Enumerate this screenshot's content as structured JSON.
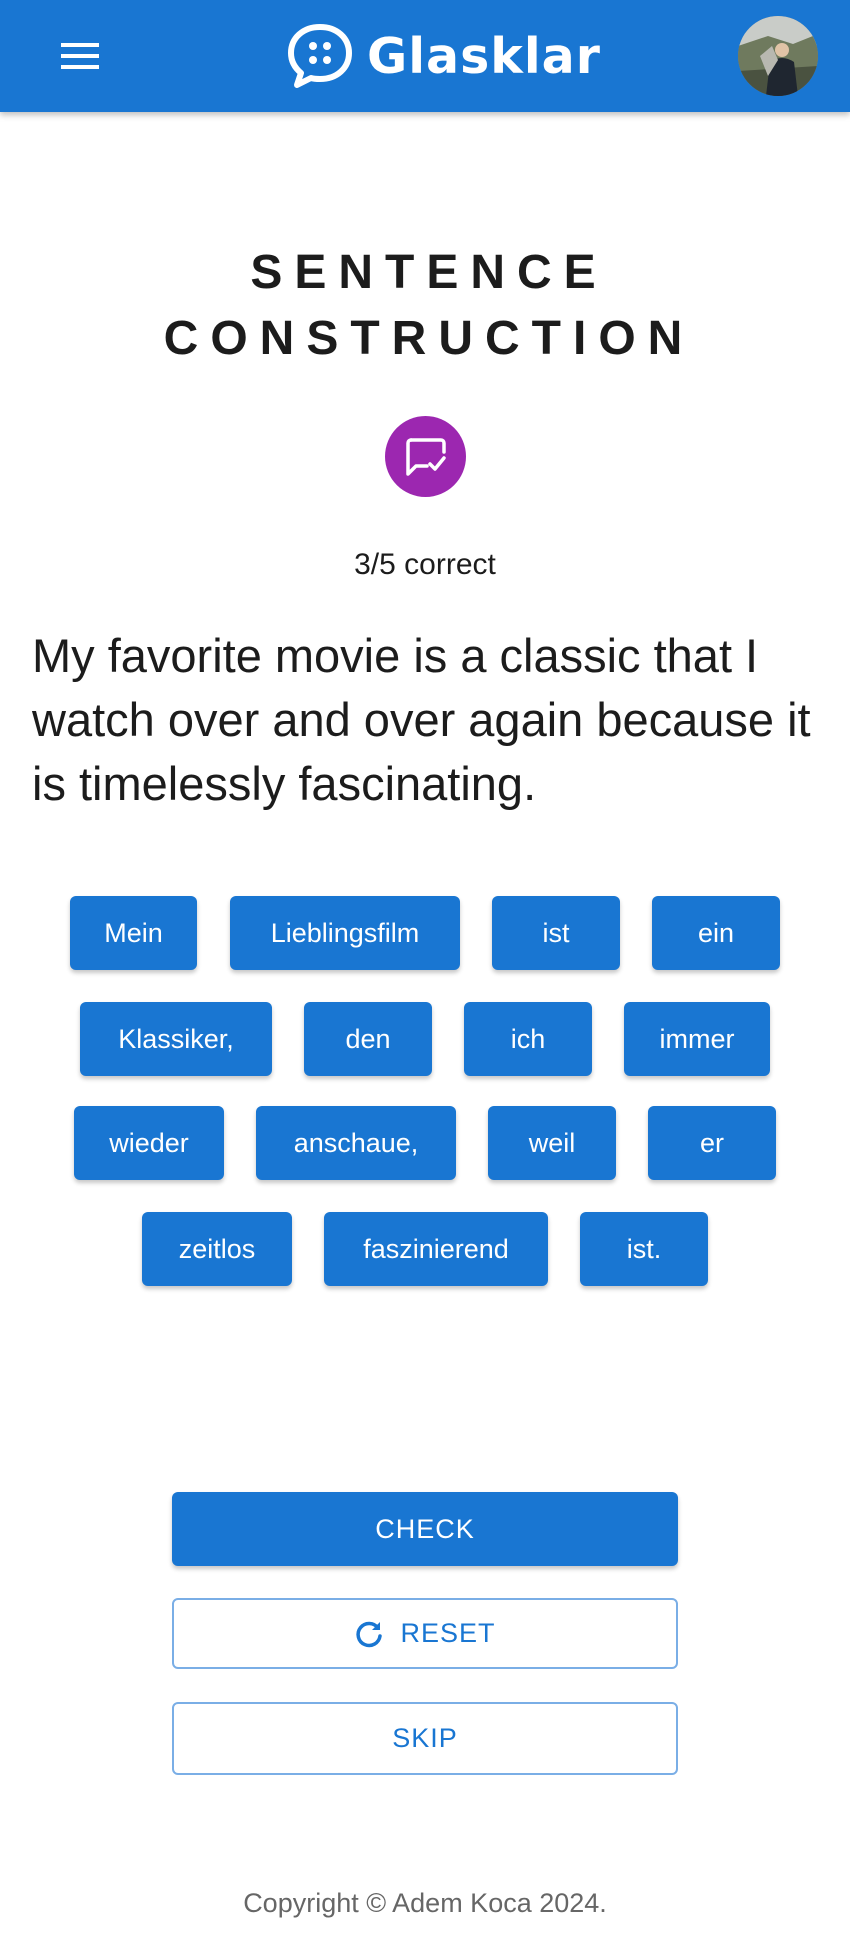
{
  "appbar": {
    "title": "Glasklar",
    "menu_icon": "menu-icon",
    "logo_icon": "chat-bubble-icon",
    "avatar": "user-avatar",
    "color": "#1976d2"
  },
  "main": {
    "title_line1": "SENTENCE",
    "title_line2": "CONSTRUCTION",
    "badge_icon": "rate-review-check-icon",
    "badge_color": "#9c27b0",
    "score": "3/5 correct",
    "prompt": "My favorite movie is a classic that I watch over and over again because it is timelessly fascinating.",
    "words": [
      "Mein",
      "Lieblingsfilm",
      "ist",
      "ein",
      "Klassiker,",
      "den",
      "ich",
      "immer",
      "wieder",
      "anschaue,",
      "weil",
      "er",
      "zeitlos",
      "faszinierend",
      "ist."
    ]
  },
  "actions": {
    "check_label": "CHECK",
    "reset_label": "RESET",
    "reset_icon": "refresh-icon",
    "skip_label": "SKIP"
  },
  "footer": {
    "copyright": "Copyright © Adem Koca 2024."
  }
}
